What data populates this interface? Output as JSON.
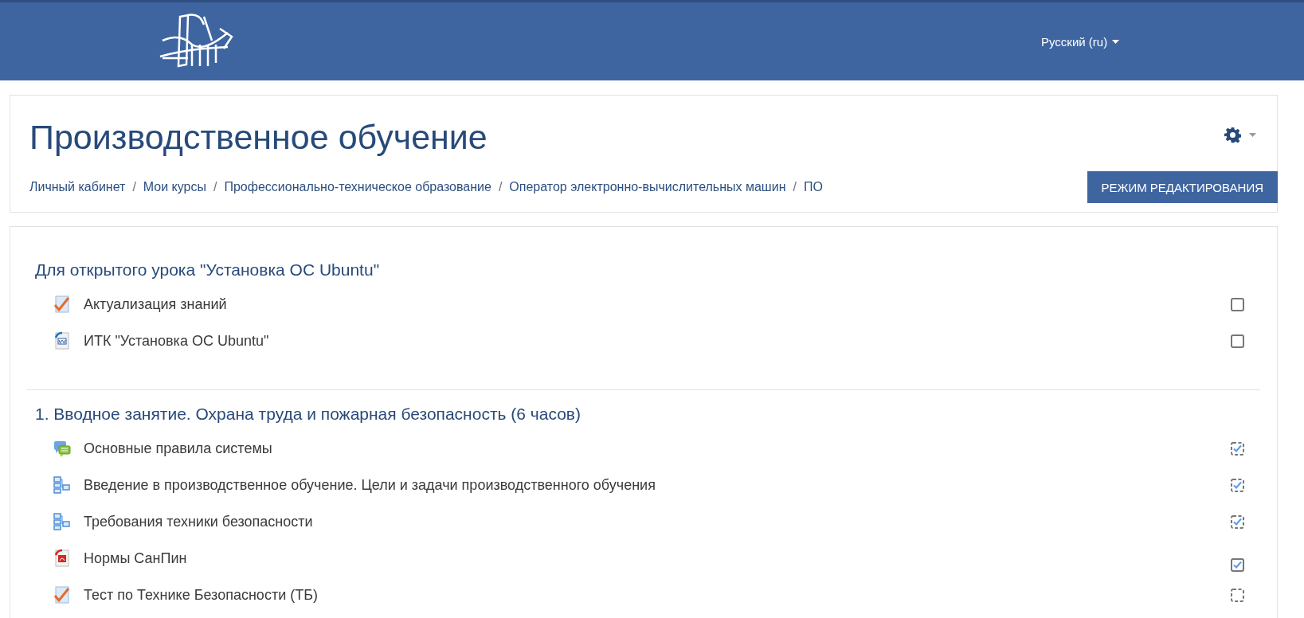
{
  "navbar": {
    "language": "Русский (ru)"
  },
  "header": {
    "title": "Производственное обучение",
    "breadcrumb": [
      {
        "kind": "link",
        "text": "Личный кабинет"
      },
      {
        "kind": "separator",
        "text": "/"
      },
      {
        "kind": "link",
        "text": "Мои курсы"
      },
      {
        "kind": "separator",
        "text": "/"
      },
      {
        "kind": "link",
        "text": "Профессионально-техническое образование"
      },
      {
        "kind": "separator",
        "text": "/"
      },
      {
        "kind": "link",
        "text": "Оператор электронно-вычислительных машин"
      },
      {
        "kind": "separator",
        "text": "/"
      },
      {
        "kind": "link",
        "text": "ПО"
      }
    ],
    "edit_button": "РЕЖИМ РЕДАКТИРОВАНИЯ"
  },
  "sections": [
    {
      "title": "Для открытого урока \"Установка ОС Ubuntu\"",
      "activities": [
        {
          "kind": "quiz",
          "name": "Актуализация знаний",
          "completion": {
            "kind": "manual",
            "checked": false
          }
        },
        {
          "kind": "word",
          "name": "ИТК \"Установка ОС Ubuntu\"",
          "completion": {
            "kind": "manual",
            "checked": false
          }
        }
      ]
    },
    {
      "title": "1. Вводное занятие. Охрана труда и пожарная безопасность (6 часов)",
      "activities": [
        {
          "kind": "forum",
          "name": "Основные правила системы",
          "completion": {
            "kind": "auto",
            "checked": true
          }
        },
        {
          "kind": "book",
          "name": "Введение в производственное обучение. Цели и задачи производственного обучения",
          "completion": {
            "kind": "auto",
            "checked": true
          }
        },
        {
          "kind": "book",
          "name": "Требования техники безопасности",
          "completion": {
            "kind": "auto",
            "checked": true
          }
        },
        {
          "kind": "pdf",
          "name": "Нормы СанПин",
          "completion": {
            "kind": "manual",
            "checked": true
          }
        },
        {
          "kind": "quiz",
          "name": "Тест по Технике Безопасности (ТБ)",
          "completion": {
            "kind": "auto",
            "checked": false
          }
        }
      ]
    }
  ]
}
